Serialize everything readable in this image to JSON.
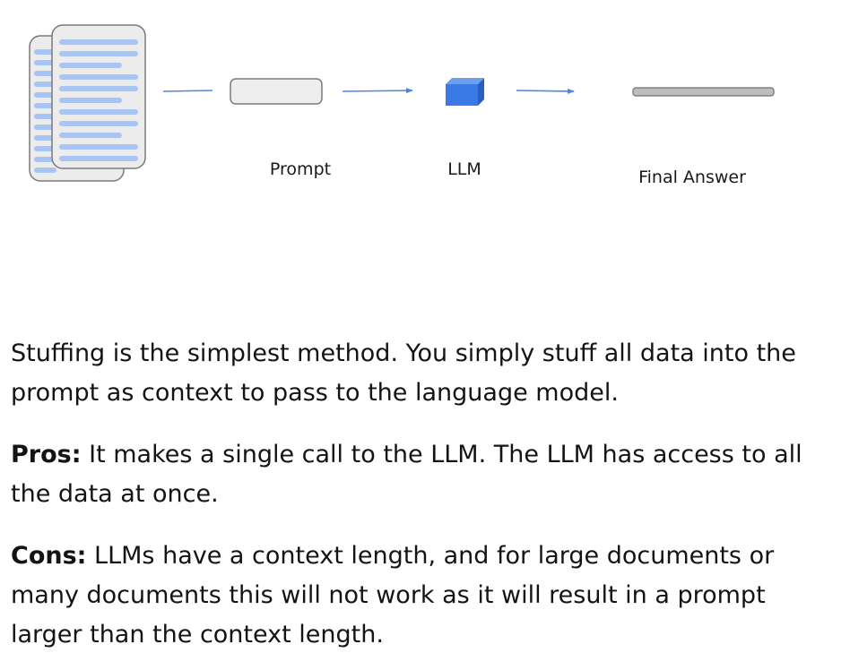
{
  "diagram": {
    "labels": {
      "prompt": "Prompt",
      "llm": "LLM",
      "final_answer": "Final Answer"
    },
    "colors": {
      "document_text_lines": "#a9c5f3",
      "document_fill": "#ececec",
      "document_stroke": "#7a7a7a",
      "arrow": "#4a86e8",
      "llm_cube": "#3b7ae6",
      "prompt_box_fill": "#eeeeee",
      "answer_bar": "#bdbdbd"
    },
    "icons": [
      "documents-stack-icon",
      "prompt-box-icon",
      "llm-cube-icon",
      "final-answer-bar-icon",
      "arrow-icon"
    ]
  },
  "text": {
    "intro": "Stuffing is the simplest method. You simply stuff all data into the prompt as context to pass to the language model.",
    "pros_label": "Pros:",
    "pros_body": " It makes a single call to the LLM. The LLM has access to all the data at once.",
    "cons_label": "Cons:",
    "cons_body": " LLMs have a context length, and for large documents or many documents this will not work as it will result in a prompt larger than the context length."
  }
}
